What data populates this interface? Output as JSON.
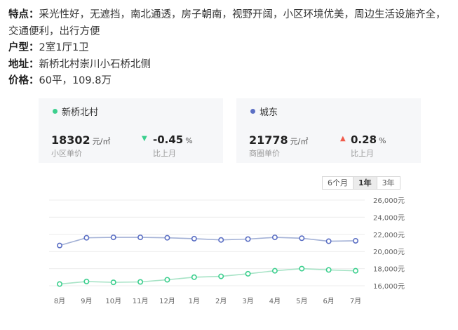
{
  "description": {
    "features_label": "特点：",
    "features_text": "采光性好，无遮挡，南北通透，房子朝南，视野开阔，小区环境优美，周边生活设施齐全，交通便利，出行方便",
    "layout_label": "户型：",
    "layout_text": "2室1厅1卫",
    "address_label": "地址：",
    "address_text": "新桥北村崇川小石桥北侧",
    "price_label": "价格：",
    "price_text": "60平，109.8万"
  },
  "cards": [
    {
      "name": "新桥北村",
      "dot_color": "#3ccf8e",
      "price": "18302",
      "unit": "元/㎡",
      "price_label": "小区单价",
      "change": "-0.45",
      "change_unit": "%",
      "change_dir": "down",
      "change_color": "#3ccf8e",
      "change_label": "比上月"
    },
    {
      "name": "城东",
      "dot_color": "#5b6fc4",
      "price": "21778",
      "unit": "元/㎡",
      "price_label": "商圈单价",
      "change": "0.28",
      "change_unit": "%",
      "change_dir": "up",
      "change_color": "#f05a4a",
      "change_label": "比上月"
    }
  ],
  "range_tabs": [
    {
      "label": "6个月",
      "active": false
    },
    {
      "label": "1年",
      "active": true
    },
    {
      "label": "3年",
      "active": false
    }
  ],
  "chart_data": {
    "type": "line",
    "title": "",
    "xlabel": "",
    "ylabel": "",
    "categories": [
      "8月",
      "9月",
      "10月",
      "11月",
      "12月",
      "1月",
      "2月",
      "3月",
      "4月",
      "5月",
      "6月",
      "7月"
    ],
    "ylim": [
      14000,
      26000
    ],
    "yticks": [
      16000,
      18000,
      20000,
      22000,
      24000,
      26000
    ],
    "ytick_labels": [
      "16,000元",
      "18,000元",
      "20,000元",
      "22,000元",
      "24,000元",
      "26,000元"
    ],
    "grid": true,
    "series": [
      {
        "name": "城东",
        "color": "#a3b1d6",
        "marker_color": "#5b6fc4",
        "values": [
          20700,
          21600,
          21650,
          21650,
          21600,
          21500,
          21350,
          21450,
          21650,
          21550,
          21200,
          21250
        ]
      },
      {
        "name": "新桥北村",
        "color": "#a7e3c6",
        "marker_color": "#3ccf8e",
        "values": [
          16200,
          16500,
          16400,
          16450,
          16700,
          17000,
          17100,
          17400,
          17750,
          18000,
          17850,
          17750
        ]
      }
    ]
  }
}
